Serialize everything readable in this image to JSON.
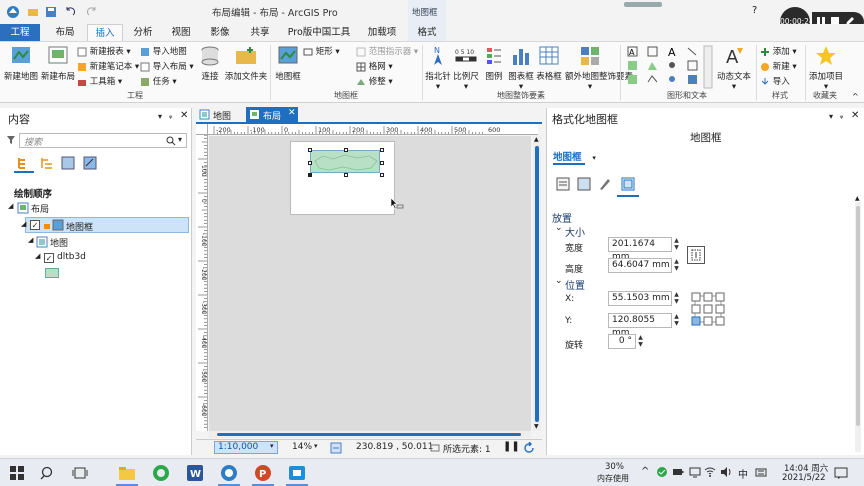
{
  "window": {
    "title": "布局编辑 - 布局 - ArcGIS Pro",
    "context_tab_group": "地图框",
    "help": "?",
    "sign_in": "登",
    "recording_time": "00:00:24"
  },
  "tabs": [
    "工程",
    "布局",
    "插入",
    "分析",
    "视图",
    "影像",
    "共享",
    "Pro版中国工具",
    "加载项",
    "格式"
  ],
  "ribbon": {
    "project": {
      "new_map": "新建地图",
      "new_layout": "新建布局",
      "new_report": "新建报表",
      "new_notebook": "新建笔记本",
      "toolbox": "工具箱",
      "import_map": "导入地图",
      "import_layout": "导入布局",
      "task": "任务",
      "connect": "连接",
      "add_folder": "添加文件夹",
      "label": "工程"
    },
    "mapframe": {
      "map_frame": "地图框",
      "rectangle": "矩形",
      "extent_indicator": "范围指示器",
      "grid": "格网",
      "reshape": "修整",
      "label": "地图框"
    },
    "surround": {
      "north_arrow": "指北针",
      "scale_bar": "比例尺",
      "legend": "图例",
      "chart_frame": "图表框",
      "table_frame": "表格框",
      "dynamic_elements": "额外地图整饰要素",
      "label": "地图整饰要素"
    },
    "graphics": {
      "dynamic_text": "动态文本",
      "label": "图形和文本"
    },
    "styles": {
      "add_style": "添加",
      "new_style": "新建",
      "import_style": "导入",
      "label": "样式"
    },
    "favorites": {
      "add_item": "添加项目",
      "label": "收藏夹"
    }
  },
  "contents": {
    "title": "内容",
    "search_placeholder": "搜索",
    "drawing_order": "绘制顺序",
    "tree": {
      "layout": "布局",
      "map_frame": "地图框",
      "map": "地图",
      "layer": "dltb3d"
    }
  },
  "doc_tabs": {
    "map": "地图",
    "layout": "布局"
  },
  "ruler_top": [
    "-200",
    "-100",
    "0",
    "100",
    "200",
    "300",
    "400",
    "500",
    "600"
  ],
  "ruler_left": [
    "100",
    "0",
    "-100",
    "-200",
    "-300",
    "-400",
    "-500",
    "-600"
  ],
  "statusbar": {
    "scale": "1:10,000",
    "zoom": "14%",
    "coords": "230.819 , 50.011",
    "selected": "所选元素: 1"
  },
  "format_pane": {
    "title": "格式化地图框",
    "subtitle": "地图框",
    "dropdown": "地图框",
    "placement": "放置",
    "size_heading": "大小",
    "width_label": "宽度",
    "width_value": "201.1674 mm",
    "height_label": "高度",
    "height_value": "64.6047 mm",
    "position_heading": "位置",
    "x_label": "X:",
    "x_value": "55.1503 mm",
    "y_label": "Y:",
    "y_value": "120.8055 mm",
    "rotation_label": "旋转",
    "rotation_value": "0 °"
  },
  "taskbar": {
    "cpu": "30%",
    "memory_label": "内存使用",
    "ime": "中",
    "time": "14:04 周六",
    "date": "2021/5/22"
  },
  "colors": {
    "accent": "#1e6fc0",
    "file_tab": "#2d6fbf",
    "context_tab": "#f0f0f0",
    "selection": "#cde3f7",
    "map_green": "#b8e0c4"
  }
}
